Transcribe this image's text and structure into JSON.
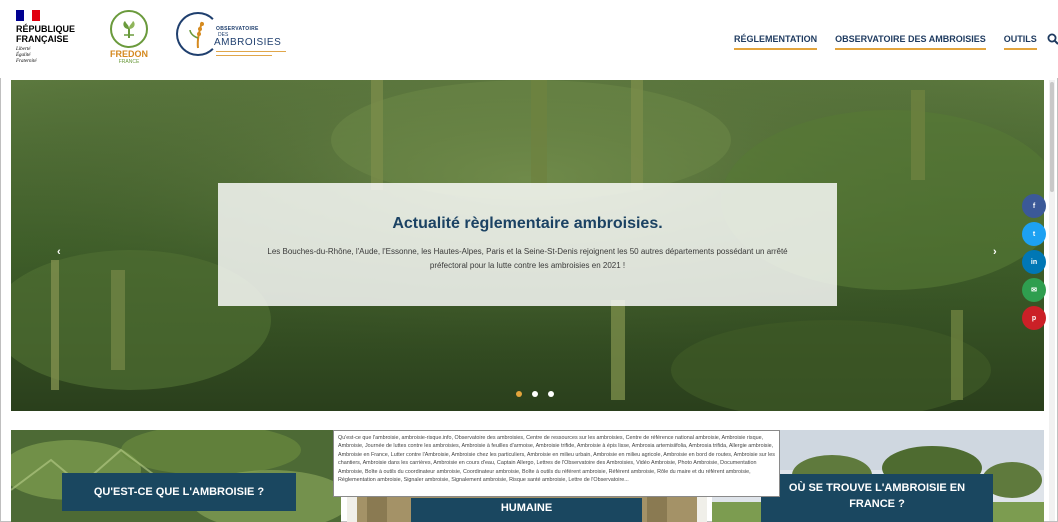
{
  "header": {
    "rf_title_line1": "RÉPUBLIQUE",
    "rf_title_line2": "FRANÇAISE",
    "rf_motto_1": "Liberté",
    "rf_motto_2": "Égalité",
    "rf_motto_3": "Fraternité",
    "fredon_name": "FREDON",
    "fredon_sub": "FRANCE",
    "oda_line1": "OBSERVATOIRE",
    "oda_line2": "DES",
    "oda_line3": "AMBROISIES",
    "nav": [
      {
        "label": "RÉGLEMENTATION"
      },
      {
        "label": "OBSERVATOIRE DES AMBROISIES"
      },
      {
        "label": "OUTILS"
      }
    ],
    "search_icon": "search-icon"
  },
  "hero": {
    "title": "Actualité règlementaire ambroisies.",
    "text": "Les Bouches-du-Rhône, l'Aude, l'Essonne, les Hautes-Alpes, Paris et la Seine-St-Denis rejoignent les 50 autres départements possédant un arrêté préfectoral pour la lutte contre les ambroisies en 2021 !",
    "prev_arrow": "‹",
    "next_arrow": "›",
    "slides_count": 3,
    "active_slide": 1
  },
  "share": [
    {
      "icon": "facebook-icon",
      "glyph": "f",
      "color": "#3b5998"
    },
    {
      "icon": "twitter-icon",
      "glyph": "t",
      "color": "#1da1f2"
    },
    {
      "icon": "linkedin-icon",
      "glyph": "in",
      "color": "#0077b5"
    },
    {
      "icon": "email-icon",
      "glyph": "✉",
      "color": "#2f9e4f"
    },
    {
      "icon": "pinterest-icon",
      "glyph": "p",
      "color": "#cb2027"
    }
  ],
  "cards": [
    {
      "label": "QU'EST-CE QUE L'AMBROISIE ?"
    },
    {
      "label": "HUMAINE"
    },
    {
      "label_line1": "OÙ SE TROUVE L'AMBROISIE EN",
      "label_line2": "FRANCE ?"
    }
  ],
  "tooltip": "Qu'est-ce que l'ambroisie, ambroisie-risque.info, Observatoire des ambroisies, Centre de ressources sur les ambroisies, Centre de référence national ambroisie, Ambroisie risque, Ambroisie, Journée de luttes contre les ambroisies, Ambroisie à feuilles d'armoise, Ambroisie trifide, Ambroisie à épis lisse, Ambrosia artemisiifolia, Ambrosia trifida, Allergie ambroisie, Ambroisie en France, Lutter contre l'Ambroisie, Ambroisie chez les particuliers, Ambroisie en milieu urbain, Ambroisie en milieu agricole, Ambroisie en bord de routes, Ambroisie sur les chantiers, Ambroisie dans les carrières, Ambroisie en cours d'eau, Captain Allergo, Lettres de l'Observatoire des Ambroisies, Vidéo Ambroisie, Photo Ambroisie, Documentation Ambroisie, Boîte à outils du coordinateur ambroisie, Coordinateur ambroisie, Boîte à outils du référent ambroisie, Référent ambroisie, Rôle du maire et du référent ambroisie, Réglementation ambroisie, Signaler ambroisie, Signalement ambroisie, Risque santé ambroisie, Lettre de l'Observatoire..."
}
